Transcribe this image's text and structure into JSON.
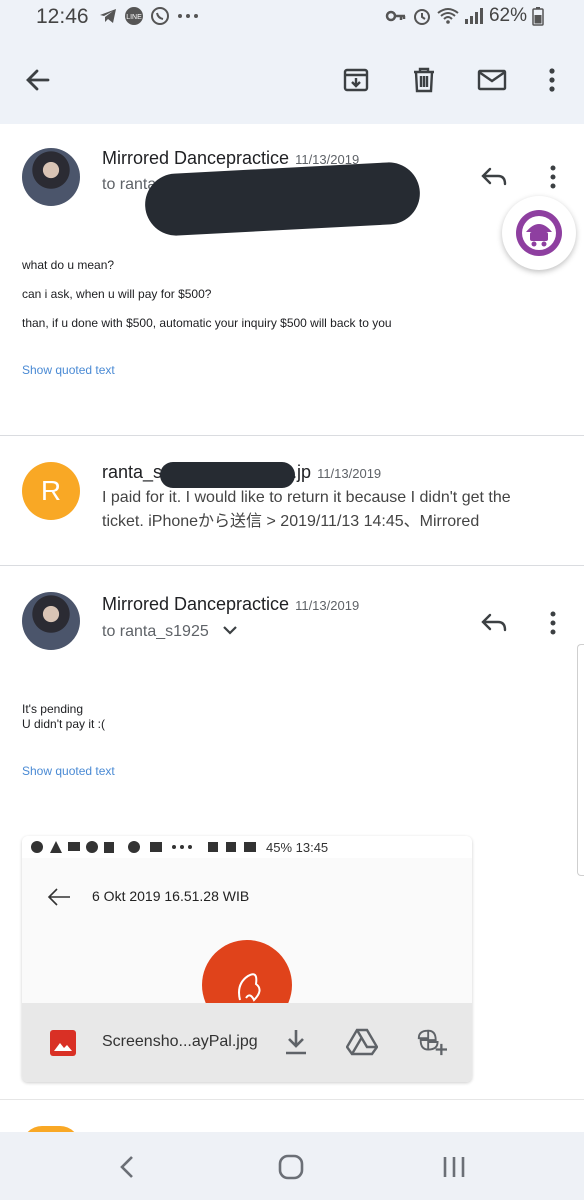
{
  "status_bar": {
    "time": "12:46",
    "battery": "62%",
    "icons": [
      "telegram-icon",
      "line-icon",
      "whatsapp-icon",
      "more-dots-icon",
      "key-icon",
      "alarm-icon",
      "wifi-icon",
      "signal-icon",
      "battery-icon"
    ]
  },
  "app_bar": {
    "back": "back-arrow-icon",
    "actions": [
      "archive-icon",
      "delete-icon",
      "mark-unread-icon",
      "overflow-menu-icon"
    ]
  },
  "messages": [
    {
      "sender": "Mirrored Dancepractice",
      "date": "11/13/2019",
      "to": "to ranta",
      "body": [
        "what do u mean?",
        "can i ask, when u will pay for $500?",
        "than, if u done with $500, automatic your inquiry $500 will back to you"
      ],
      "quoted_link": "Show quoted text"
    },
    {
      "sender_start": "ranta_s",
      "sender_end": ".jp",
      "date": "11/13/2019",
      "avatar_letter": "R",
      "snippet": "I paid for it. I would like to return it because I didn't get the ticket. iPhoneから送信 > 2019/11/13 14:45、Mirrored"
    },
    {
      "sender": "Mirrored Dancepractice",
      "date": "11/13/2019",
      "to": "to ranta_s1925",
      "body": [
        "It's pending",
        "U didn't pay it :("
      ],
      "quoted_link": "Show quoted text"
    }
  ],
  "attachment": {
    "preview_status_time": "45% 13:45",
    "preview_title": "6 Okt 2019 16.51.28 WIB",
    "file_name": "Screensho...ayPal.jpg",
    "actions": [
      "download-icon",
      "drive-icon",
      "photos-add-icon"
    ]
  },
  "colors": {
    "accent_link": "#4a8ad4",
    "avatar_letter_bg": "#f9a825",
    "fab_purple": "#8e3fa0",
    "attachment_red": "#e0431b"
  }
}
